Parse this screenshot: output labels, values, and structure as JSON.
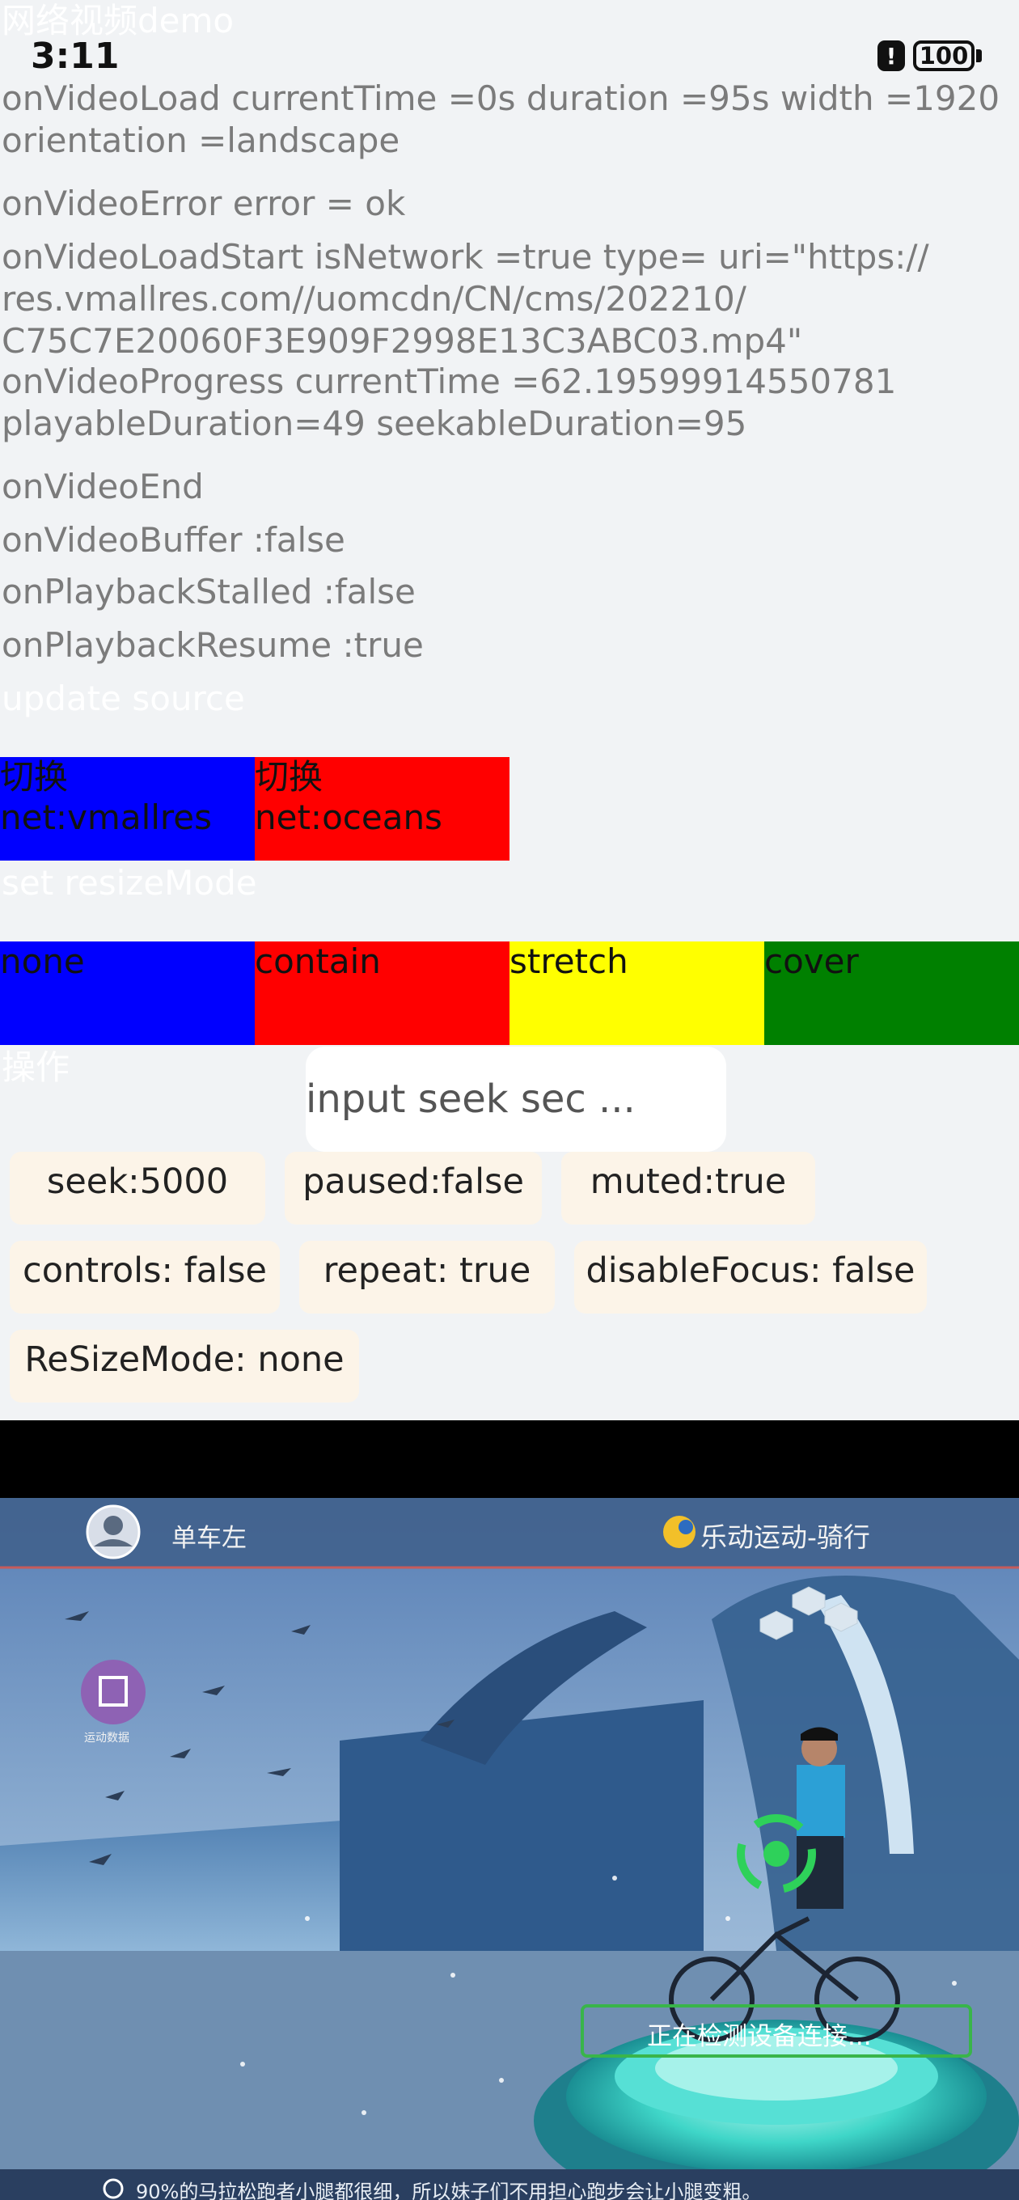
{
  "status": {
    "time": "3:11",
    "battery": "100"
  },
  "page": {
    "title": "网络视频demo"
  },
  "logs": {
    "load": "onVideoLoad currentTime =0s duration =95s width =1920\norientation =landscape",
    "error": "onVideoError error = ok",
    "load_start": "onVideoLoadStart isNetwork =true type= uri=\"https://\nres.vmallres.com//uomcdn/CN/cms/202210/\nC75C7E20060F3E909F2998E13C3ABC03.mp4\"",
    "progress": "onVideoProgress currentTime =62.19599914550781\nplayableDuration=49 seekableDuration=95",
    "end": "onVideoEnd",
    "buffer": "onVideoBuffer :false",
    "stalled": "onPlaybackStalled :false",
    "resume": "onPlaybackResume :true"
  },
  "source_section": {
    "title": "update source",
    "buttons": [
      {
        "label": "切换\nnet:vmallres",
        "color": "#0000ff"
      },
      {
        "label": "切换\nnet:oceans",
        "color": "#ff0000"
      }
    ]
  },
  "resize_section": {
    "title": "set resizeMode",
    "buttons": [
      {
        "label": "none",
        "color": "#0000ff"
      },
      {
        "label": "contain",
        "color": "#ff0000"
      },
      {
        "label": "stretch",
        "color": "#ffff00"
      },
      {
        "label": "cover",
        "color": "#008000"
      }
    ]
  },
  "ops_section": {
    "title": "操作",
    "seek_placeholder": "input seek sec ...",
    "chips": {
      "seek": "seek:5000",
      "paused": "paused:false",
      "muted": "muted:true",
      "controls": "controls: false",
      "repeat": "repeat: true",
      "disable_focus": "disableFocus: false",
      "resize_mode": "ReSizeMode: none"
    }
  },
  "video": {
    "top_left_label": "单车左",
    "top_right_label": "乐动运动-骑行",
    "side_badge_label": "运动数据",
    "connecting_text": "正在检测设备连接...",
    "tip_text": "90%的马拉松跑者小腿都很细，所以妹子们不用担心跑步会让小腿变粗。"
  }
}
